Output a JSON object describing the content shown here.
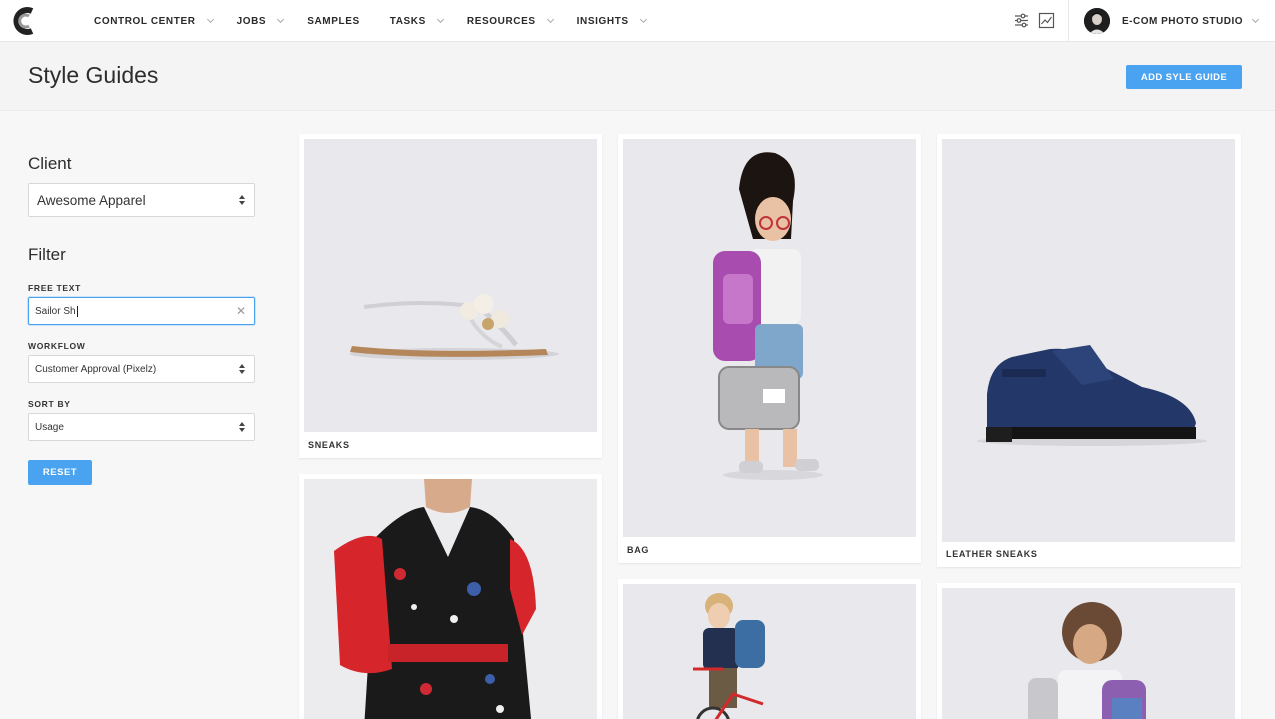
{
  "nav": {
    "items": [
      {
        "label": "CONTROL CENTER",
        "dropdown": true
      },
      {
        "label": "JOBS",
        "dropdown": true
      },
      {
        "label": "SAMPLES",
        "dropdown": false
      },
      {
        "label": "TASKS",
        "dropdown": true
      },
      {
        "label": "RESOURCES",
        "dropdown": true
      },
      {
        "label": "INSIGHTS",
        "dropdown": true
      }
    ],
    "tools": [
      "sliders-icon",
      "chart-icon"
    ],
    "studio": "E-COM PHOTO STUDIO"
  },
  "header": {
    "title": "Style Guides",
    "add_button": "ADD SYLE GUIDE"
  },
  "sidebar": {
    "client_heading": "Client",
    "client_value": "Awesome Apparel",
    "filter_heading": "Filter",
    "free_text_label": "FREE TEXT",
    "free_text_value": "Sailor Sh",
    "workflow_label": "WORKFLOW",
    "workflow_value": "Customer Approval (Pixelz)",
    "sort_label": "SORT BY",
    "sort_value": "Usage",
    "reset": "RESET"
  },
  "cards": [
    {
      "label": "SNEAKS"
    },
    {
      "label": "BAG"
    },
    {
      "label": "LEATHER SNEAKS"
    },
    {
      "label": ""
    },
    {
      "label": ""
    },
    {
      "label": ""
    }
  ],
  "colors": {
    "accent": "#4aa3f0",
    "text": "#2d2d2d"
  }
}
